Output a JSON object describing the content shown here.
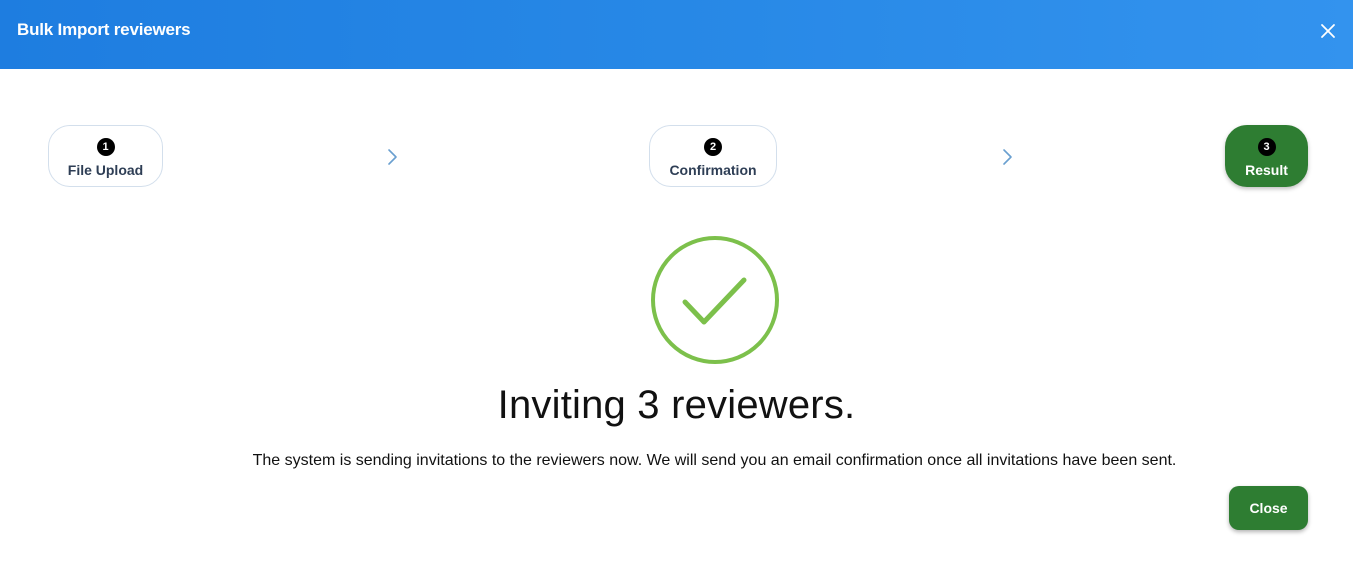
{
  "dialog": {
    "title": "Bulk Import reviewers",
    "close_icon": "close-icon"
  },
  "steps": [
    {
      "number": "1",
      "label": "File Upload",
      "active": false
    },
    {
      "number": "2",
      "label": "Confirmation",
      "active": false
    },
    {
      "number": "3",
      "label": "Result",
      "active": true
    }
  ],
  "result": {
    "icon": "check-circle-icon",
    "headline": "Inviting 3 reviewers.",
    "description": "The system is sending invitations to the reviewers now. We will send you an email confirmation once all invitations have been sent."
  },
  "footer": {
    "close_label": "Close"
  },
  "colors": {
    "header_start": "#1e7de0",
    "header_end": "#3393ee",
    "active_step": "#2e7d32",
    "success_ring": "#7cc04b",
    "chevron": "#6a9fd0"
  }
}
